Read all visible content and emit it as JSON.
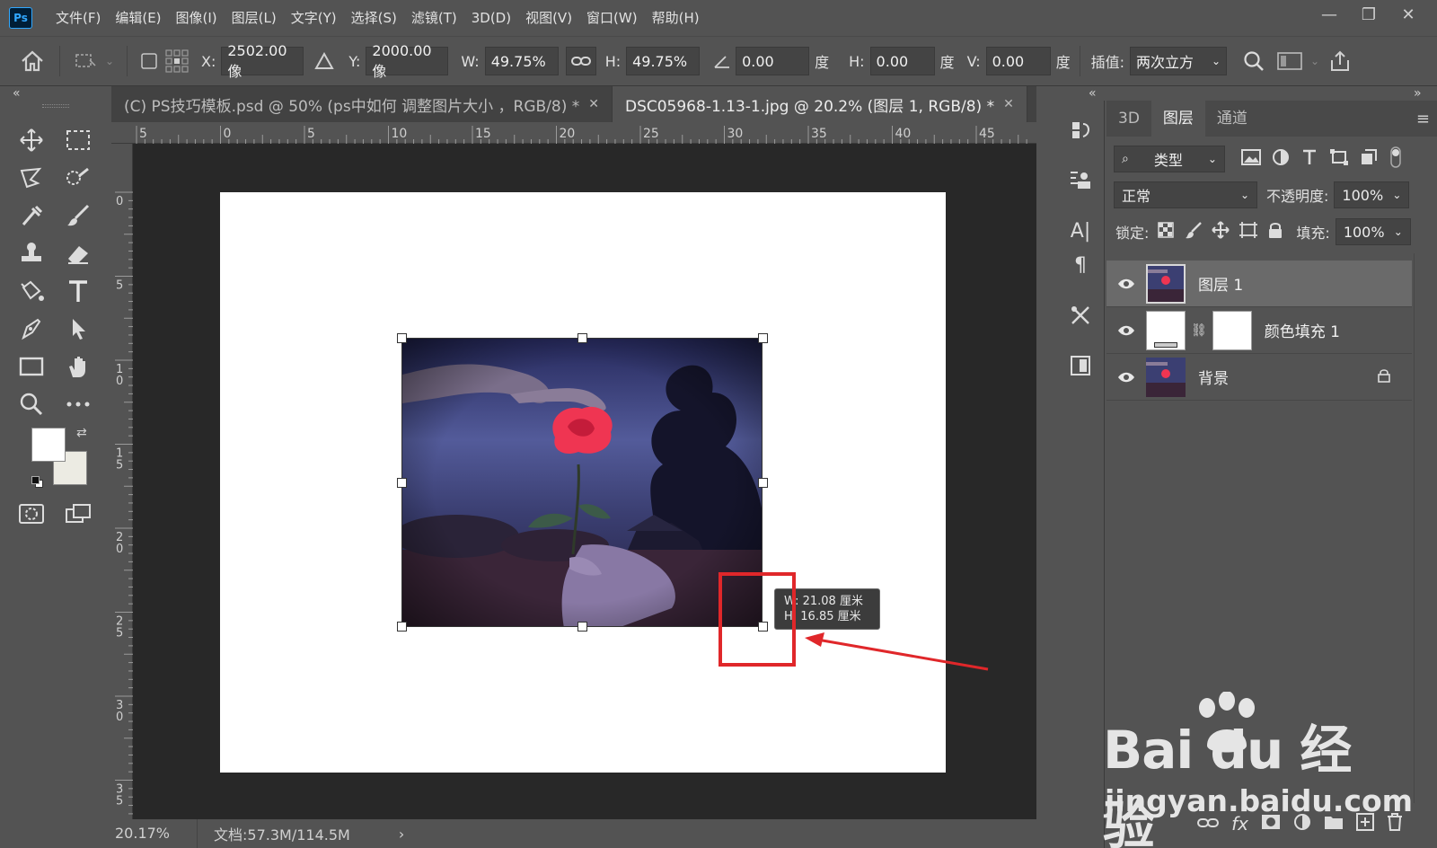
{
  "app": {
    "logo": "Ps"
  },
  "menu": [
    "文件(F)",
    "编辑(E)",
    "图像(I)",
    "图层(L)",
    "文字(Y)",
    "选择(S)",
    "滤镜(T)",
    "3D(D)",
    "视图(V)",
    "窗口(W)",
    "帮助(H)"
  ],
  "window_controls": {
    "minimize": "—",
    "restore": "❐",
    "close": "✕"
  },
  "options": {
    "x_label": "X:",
    "x_value": "2502.00 像",
    "y_label": "Y:",
    "y_value": "2000.00 像",
    "w_label": "W:",
    "w_value": "49.75%",
    "h_label": "H:",
    "h_value": "49.75%",
    "angle_value": "0.00",
    "angle_unit": "度",
    "hskew_label": "H:",
    "hskew_value": "0.00",
    "hskew_unit": "度",
    "vskew_label": "V:",
    "vskew_value": "0.00",
    "vskew_unit": "度",
    "interp_label": "插值:",
    "interp_value": "两次立方"
  },
  "tabs": [
    {
      "label": "(C) PS技巧模板.psd @ 50% (ps中如何 调整图片大小 ，RGB/8) *",
      "close": "✕"
    },
    {
      "label": "DSC05968-1.13-1.jpg @ 20.2% (图层 1, RGB/8) *",
      "close": "✕"
    }
  ],
  "ruler_h": [
    "5",
    "0",
    "5",
    "10",
    "15",
    "20",
    "25",
    "30",
    "35",
    "40",
    "45"
  ],
  "ruler_v": [
    "0",
    "5",
    "10",
    "15",
    "20",
    "25",
    "30",
    "35"
  ],
  "tooltip": {
    "w_line": "W: 21.08 厘米",
    "h_line": "H: 16.85 厘米"
  },
  "status": {
    "zoom": "20.17%",
    "doc": "文档:57.3M/114.5M",
    "arrow": "›"
  },
  "panel": {
    "tabs": [
      "3D",
      "图层",
      "通道"
    ],
    "filter_label": "类型",
    "blend_mode": "正常",
    "opacity_label": "不透明度:",
    "opacity_value": "100%",
    "lock_label": "锁定:",
    "fill_label": "填充:",
    "fill_value": "100%",
    "layers": [
      {
        "name": "图层 1"
      },
      {
        "name": "颜色填充 1"
      },
      {
        "name": "背景"
      }
    ],
    "bottom_fx": "fx"
  },
  "mini_panel": {
    "char_a": "A|",
    "para": "¶"
  },
  "watermark": {
    "brand": "Bai du 经验",
    "url": "jingyan.baidu.com"
  },
  "colors": {
    "ui_bg": "#535353",
    "canvas_bg": "#282828",
    "highlight": "#e0272a",
    "ps_blue": "#31a8ff"
  }
}
